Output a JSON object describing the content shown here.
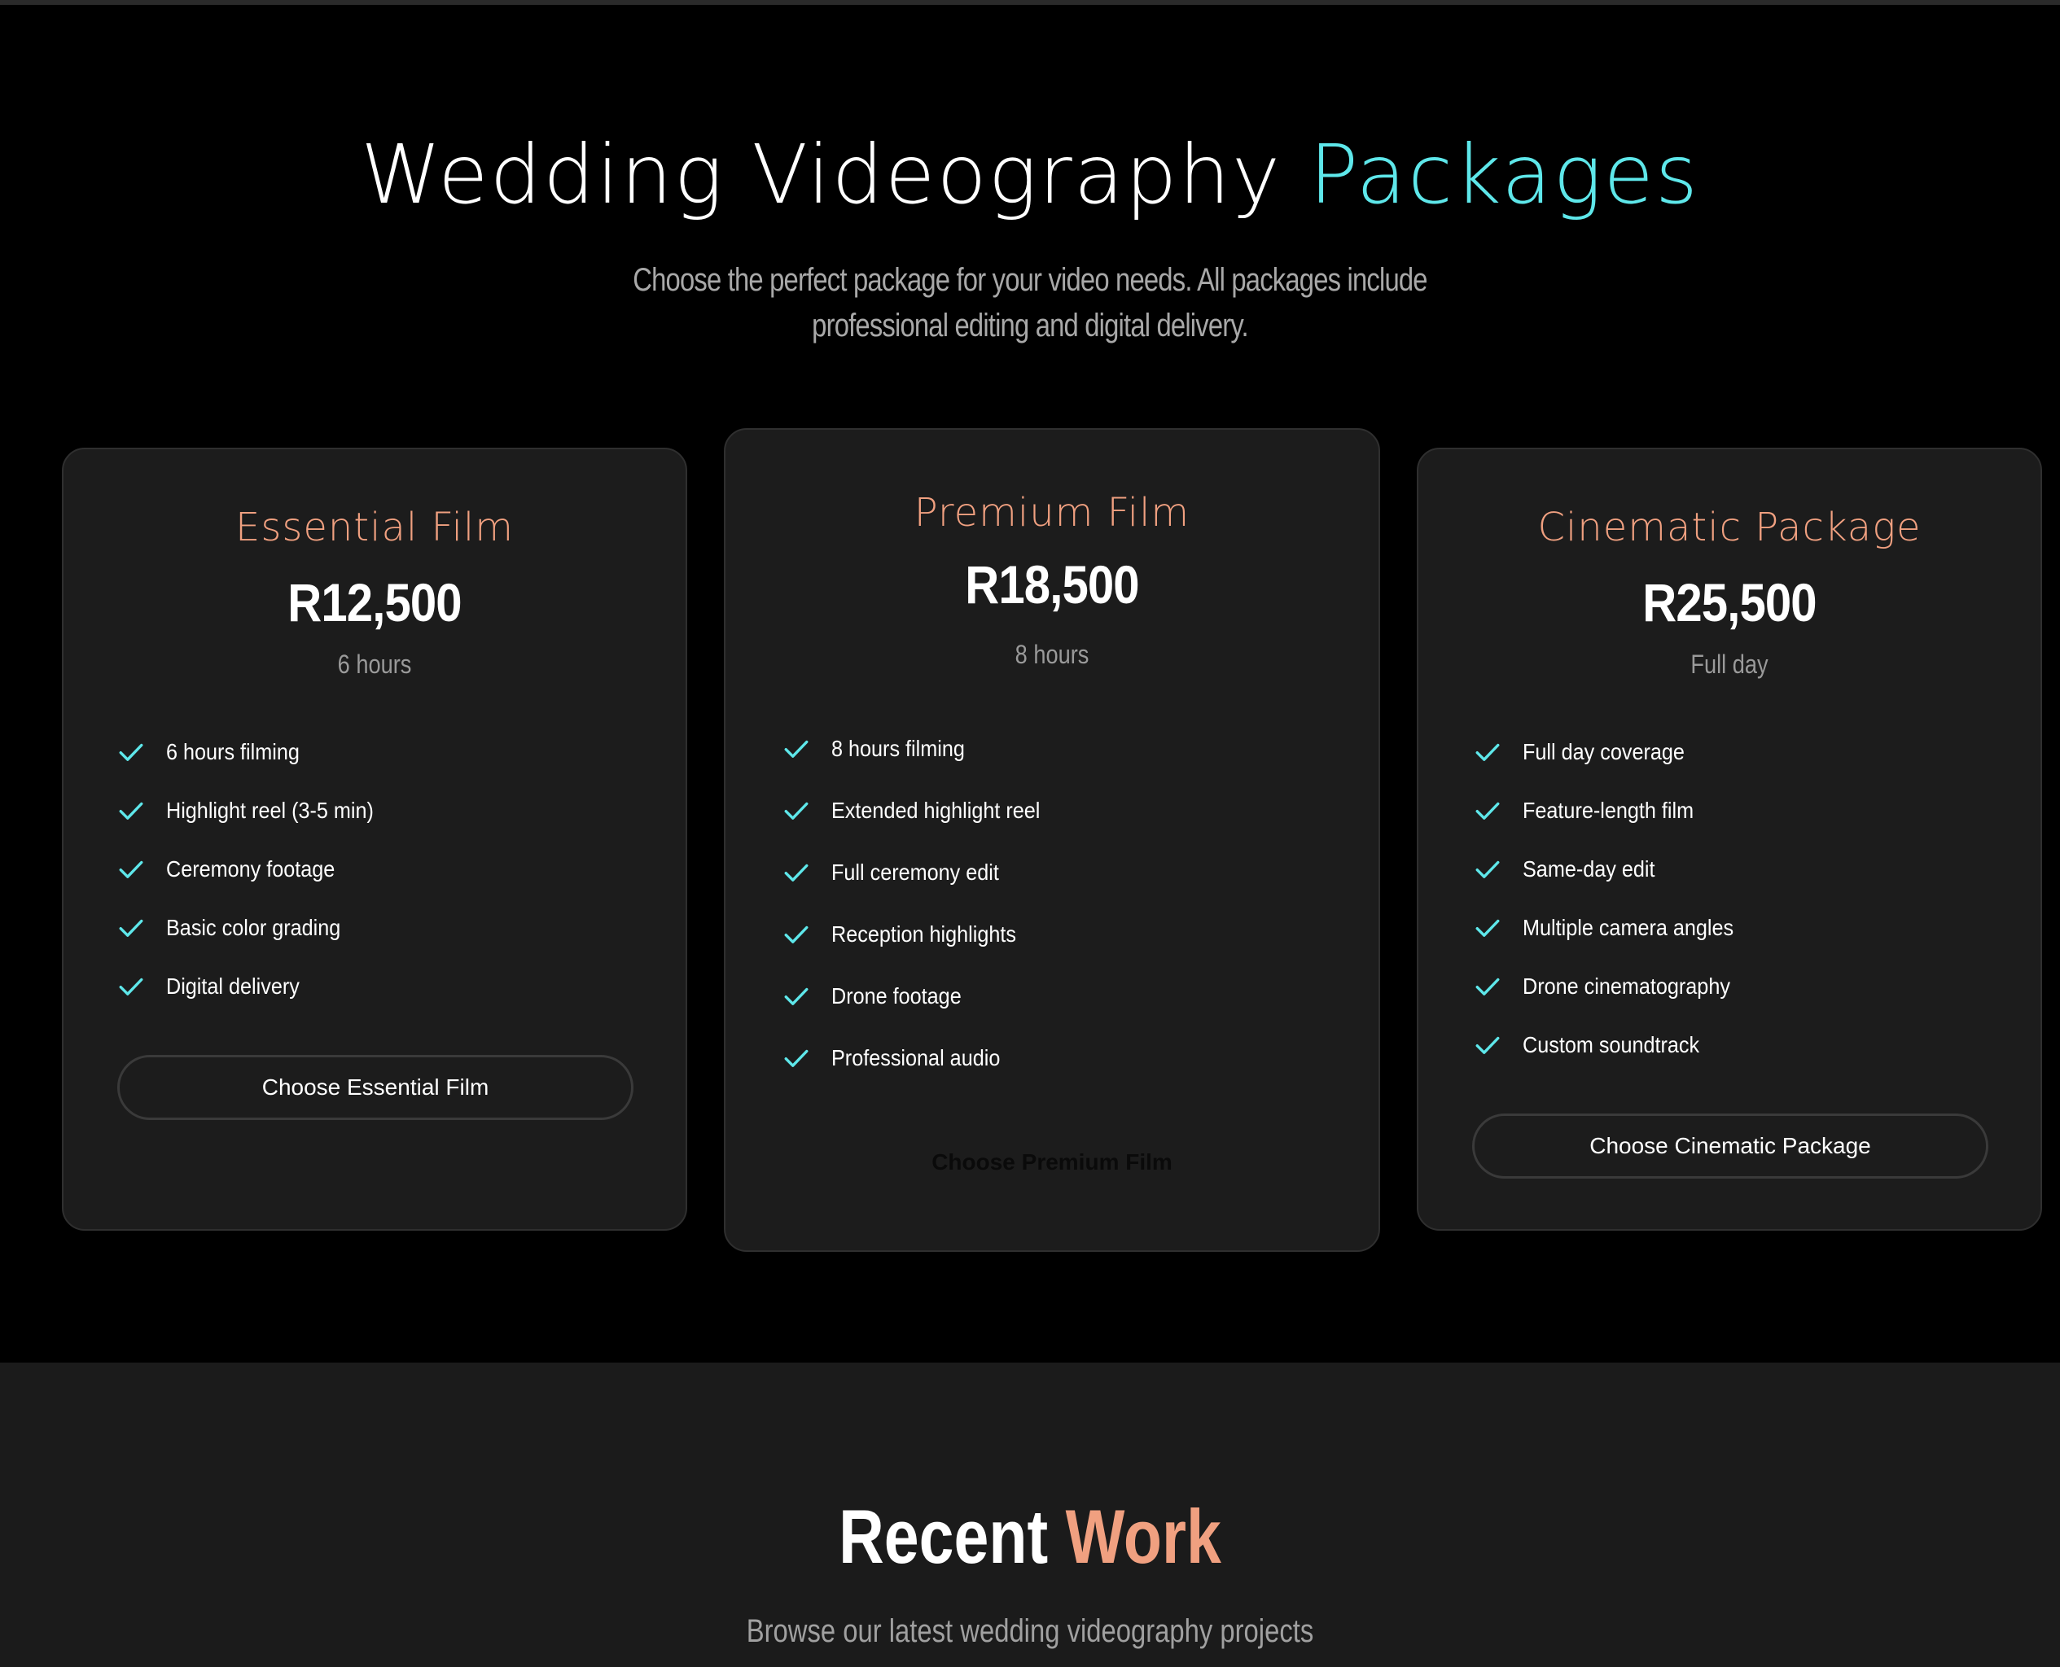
{
  "packages_section": {
    "heading_main": "Wedding Videography ",
    "heading_accent": "Packages",
    "subtitle": "Choose the perfect package for your video needs. All packages include professional editing and digital delivery."
  },
  "cards": [
    {
      "title": "Essential Film",
      "price": "R12,500",
      "duration": "6 hours",
      "features": [
        "6 hours filming",
        "Highlight reel (3-5 min)",
        "Ceremony footage",
        "Basic color grading",
        "Digital delivery"
      ],
      "cta": "Choose Essential Film"
    },
    {
      "title": "Premium Film",
      "price": "R18,500",
      "duration": "8 hours",
      "features": [
        "8 hours filming",
        "Extended highlight reel",
        "Full ceremony edit",
        "Reception highlights",
        "Drone footage",
        "Professional audio"
      ],
      "cta": "Choose Premium Film"
    },
    {
      "title": "Cinematic Package",
      "price": "R25,500",
      "duration": "Full day",
      "features": [
        "Full day coverage",
        "Feature-length film",
        "Same-day edit",
        "Multiple camera angles",
        "Drone cinematography",
        "Custom soundtrack"
      ],
      "cta": "Choose Cinematic Package"
    }
  ],
  "recent_section": {
    "title_main": "Recent ",
    "title_accent": "Work",
    "subtitle": "Browse our latest wedding videography projects"
  },
  "icons": {
    "feature_check": "check-icon"
  },
  "colors": {
    "accent_cyan": "#5ee7ea",
    "accent_peach": "#f0a080",
    "card_bg": "#1c1c1c",
    "page_bg": "#000000"
  }
}
